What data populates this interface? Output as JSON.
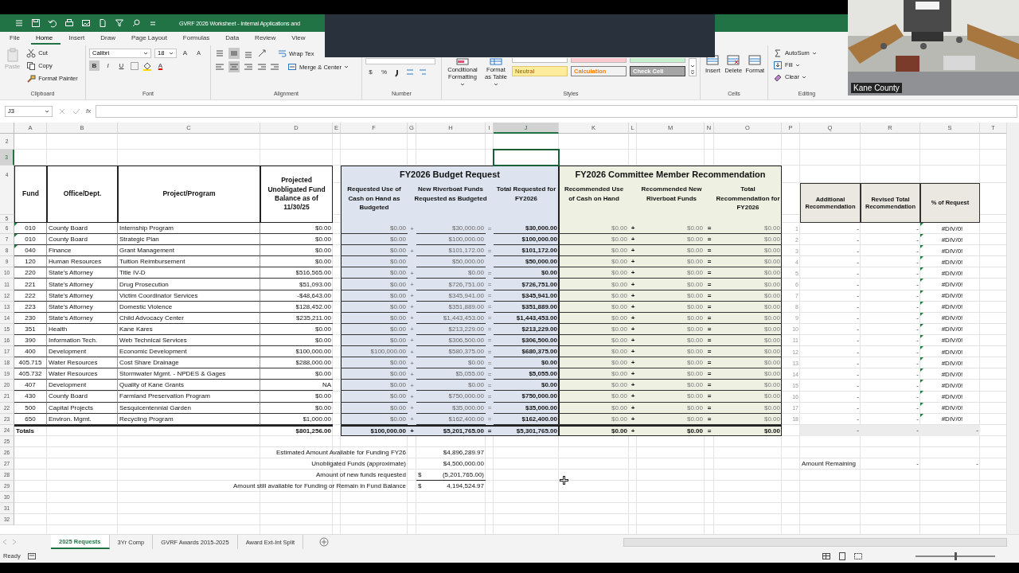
{
  "titlebar": {
    "title": "GVRF 2026 Worksheet - Internal Applications and"
  },
  "menu": [
    {
      "label": "File",
      "selected": false
    },
    {
      "label": "Home",
      "selected": true
    },
    {
      "label": "Insert",
      "selected": false
    },
    {
      "label": "Draw",
      "selected": false
    },
    {
      "label": "Page Layout",
      "selected": false
    },
    {
      "label": "Formulas",
      "selected": false
    },
    {
      "label": "Data",
      "selected": false
    },
    {
      "label": "Review",
      "selected": false
    },
    {
      "label": "View",
      "selected": false
    }
  ],
  "ribbon": {
    "clipboard": {
      "label": "Clipboard",
      "paste": {
        "text": "Paste",
        "disabled": true
      },
      "cut": "Cut",
      "copy": "Copy",
      "format_painter": "Format Painter"
    },
    "font": {
      "label": "Font",
      "family": "Calibri",
      "size": "18",
      "grow": "A",
      "shrink": "A",
      "bold": {
        "text": "B",
        "on": true
      },
      "italic": "I",
      "underline": "U",
      "font_color": "A"
    },
    "alignment": {
      "label": "Alignment",
      "middle_align_on": true,
      "center_align_on": true,
      "wrap_text": "Wrap Tex",
      "merge": "Merge & Center"
    },
    "number": {
      "label": "Number",
      "currency": "$",
      "percent": "%"
    },
    "styles": {
      "label": "Styles",
      "conditional": "Conditional Formatting",
      "format_table": "Format as Table",
      "swatches": [
        {
          "color": "#ffffff"
        },
        {
          "color": "#ffc7ce"
        },
        {
          "color": "#c6efce"
        }
      ],
      "cell_styles": [
        {
          "text": "Neutral",
          "kind": "neutral"
        },
        {
          "text": "Calculation",
          "kind": "calculation"
        },
        {
          "text": "Check Cell",
          "kind": "check"
        }
      ]
    },
    "cells": {
      "label": "Cells",
      "buttons": [
        "Insert",
        "Delete",
        "Format"
      ]
    },
    "editing": {
      "label": "Editing",
      "autosum": "AutoSum",
      "fill": "Fill",
      "clear": "Clear"
    }
  },
  "formula_bar": {
    "name_box": "J3",
    "fx": "fx"
  },
  "video": {
    "kind": "picture",
    "caption": "Kane County"
  },
  "sheet": {
    "columns": [
      {
        "label": "A",
        "selected": false
      },
      {
        "label": "B",
        "selected": false
      },
      {
        "label": "C",
        "selected": false
      },
      {
        "label": "D",
        "selected": false
      },
      {
        "label": "E",
        "selected": false
      },
      {
        "label": "F",
        "selected": false
      },
      {
        "label": "G",
        "selected": false
      },
      {
        "label": "H",
        "selected": false
      },
      {
        "label": "I",
        "selected": false
      },
      {
        "label": "J",
        "selected": true
      },
      {
        "label": "K",
        "selected": false
      },
      {
        "label": "L",
        "selected": false
      },
      {
        "label": "M",
        "selected": false
      },
      {
        "label": "N",
        "selected": false
      },
      {
        "label": "O",
        "selected": false
      },
      {
        "label": "P",
        "selected": false
      },
      {
        "label": "Q",
        "selected": false
      },
      {
        "label": "R",
        "selected": false
      },
      {
        "label": "S",
        "selected": false
      },
      {
        "label": "T",
        "selected": false
      }
    ],
    "top_rows": [
      {
        "row": "2",
        "selected": false
      },
      {
        "row": "3",
        "selected": true
      }
    ],
    "header_rows": [
      "4",
      "5"
    ],
    "headers": {
      "fund": "Fund",
      "office": "Office/Dept.",
      "project": "Project/Program",
      "balance": "Projected Unobligated Fund Balance as of 11/30/25",
      "budget_title": "FY2026 Budget Request",
      "cash": "Requested Use of Cash on Hand as Budgeted",
      "new": "New Riverboat Funds Requested as Budgeted",
      "total": "Total Requested for FY2026",
      "rec_title": "FY2026 Committee Member Recommendation",
      "rec_cash": "Recommended Use of Cash on Hand",
      "rec_new": "Recommended New Riverboat Funds",
      "rec_total": "Total Recommendation for FY2026",
      "additional": "Additional Recommendation",
      "revised": "Revised Total Recommendation",
      "percent": "% of Request"
    },
    "rows": [
      {
        "row": "6",
        "flag": true,
        "fund": "010",
        "office": "County Board",
        "project": "Internship Program",
        "balance": "$0.00",
        "cash": "$0.00",
        "op": "+",
        "new": "$30,000.00",
        "eq": "=",
        "total": "$30,000.00",
        "rec_cash": "$0.00",
        "rec_op": "+",
        "rec_new": "$0.00",
        "rec_eq": "=",
        "rec_total": "$0.00",
        "index": "1",
        "additional": "-",
        "revised": "-",
        "percent": "#DIV/0!"
      },
      {
        "row": "7",
        "flag": true,
        "fund": "010",
        "office": "County Board",
        "project": "Strategic Plan",
        "balance": "$0.00",
        "cash": "$0.00",
        "new": "$100,000.00",
        "total": "$100,000.00",
        "rec_cash": "$0.00",
        "rec_op": "+",
        "rec_new": "$0.00",
        "rec_eq": "=",
        "rec_total": "$0.00",
        "index": "2",
        "additional": "-",
        "revised": "-",
        "percent": "#DIV/0!"
      },
      {
        "row": "8",
        "flag": true,
        "fund": "040",
        "office": "Finance",
        "project": "Grant Management",
        "balance": "$0.00",
        "cash": "$0.00",
        "op": "+",
        "new": "$101,172.00",
        "eq": "=",
        "total": "$101,172.00",
        "rec_cash": "$0.00",
        "rec_op": "+",
        "rec_new": "$0.00",
        "rec_eq": "=",
        "rec_total": "$0.00",
        "index": "3",
        "additional": "-",
        "revised": "-",
        "percent": "#DIV/0!"
      },
      {
        "row": "9",
        "flag": false,
        "fund": "120",
        "office": "Human Resources",
        "project": "Tuition Reimbursement",
        "balance": "$0.00",
        "cash": "$0.00",
        "new": "$50,000.00",
        "total": "$50,000.00",
        "rec_cash": "$0.00",
        "rec_op": "+",
        "rec_new": "$0.00",
        "rec_eq": "=",
        "rec_total": "$0.00",
        "index": "4",
        "additional": "-",
        "revised": "-",
        "percent": "#DIV/0!"
      },
      {
        "row": "10",
        "flag": false,
        "fund": "220",
        "office": "State's Attorney",
        "project": "Title IV-D",
        "balance": "$516,565.00",
        "cash": "$0.00",
        "op": "+",
        "new": "$0.00",
        "eq": "=",
        "total": "$0.00",
        "rec_cash": "$0.00",
        "rec_op": "+",
        "rec_new": "$0.00",
        "rec_eq": "=",
        "rec_total": "$0.00",
        "index": "5",
        "additional": "-",
        "revised": "-",
        "percent": "#DIV/0!"
      },
      {
        "row": "11",
        "flag": false,
        "fund": "221",
        "office": "State's Attorney",
        "project": "Drug Prosecution",
        "balance": "$51,093.00",
        "cash": "$0.00",
        "op": "+",
        "new": "$726,751.00",
        "eq": "=",
        "total": "$726,751.00",
        "rec_cash": "$0.00",
        "rec_op": "+",
        "rec_new": "$0.00",
        "rec_eq": "=",
        "rec_total": "$0.00",
        "index": "6",
        "additional": "-",
        "revised": "-",
        "percent": "#DIV/0!"
      },
      {
        "row": "12",
        "flag": false,
        "fund": "222",
        "office": "State's Attorney",
        "project": "Victim Coordinator Services",
        "balance": "-$48,643.00",
        "cash": "$0.00",
        "op": "+",
        "new": "$345,941.00",
        "eq": "=",
        "total": "$345,941.00",
        "rec_cash": "$0.00",
        "rec_op": "+",
        "rec_new": "$0.00",
        "rec_eq": "=",
        "rec_total": "$0.00",
        "index": "7",
        "additional": "-",
        "revised": "-",
        "percent": "#DIV/0!"
      },
      {
        "row": "13",
        "flag": false,
        "fund": "223",
        "office": "State's Attorney",
        "project": "Domestic Violence",
        "balance": "$128,452.00",
        "cash": "$0.00",
        "op": "+",
        "new": "$351,889.00",
        "eq": "=",
        "total": "$351,889.00",
        "rec_cash": "$0.00",
        "rec_op": "+",
        "rec_new": "$0.00",
        "rec_eq": "=",
        "rec_total": "$0.00",
        "index": "8",
        "additional": "-",
        "revised": "-",
        "percent": "#DIV/0!"
      },
      {
        "row": "14",
        "flag": false,
        "fund": "230",
        "office": "State's Attorney",
        "project": "Child Advocacy Center",
        "balance": "$235,211.00",
        "cash": "$0.00",
        "op": "+",
        "new": "$1,443,453.00",
        "eq": "=",
        "total": "$1,443,453.00",
        "rec_cash": "$0.00",
        "rec_op": "+",
        "rec_new": "$0.00",
        "rec_eq": "=",
        "rec_total": "$0.00",
        "index": "9",
        "additional": "-",
        "revised": "-",
        "percent": "#DIV/0!"
      },
      {
        "row": "15",
        "flag": false,
        "fund": "351",
        "office": "Health",
        "project": "Kane Kares",
        "balance": "$0.00",
        "cash": "$0.00",
        "op": "+",
        "new": "$213,229.00",
        "eq": "=",
        "total": "$213,229.00",
        "rec_cash": "$0.00",
        "rec_op": "+",
        "rec_new": "$0.00",
        "rec_eq": "=",
        "rec_total": "$0.00",
        "index": "10",
        "additional": "-",
        "revised": "-",
        "percent": "#DIV/0!"
      },
      {
        "row": "16",
        "flag": false,
        "fund": "390",
        "office": "Information Tech.",
        "project": "Web Technical Services",
        "balance": "$0.00",
        "cash": "$0.00",
        "op": "+",
        "new": "$306,500.00",
        "eq": "=",
        "total": "$306,500.00",
        "rec_cash": "$0.00",
        "rec_op": "+",
        "rec_new": "$0.00",
        "rec_eq": "=",
        "rec_total": "$0.00",
        "index": "11",
        "additional": "-",
        "revised": "-",
        "percent": "#DIV/0!"
      },
      {
        "row": "17",
        "flag": false,
        "fund": "400",
        "office": "Development",
        "project": "Economic Development",
        "balance": "$100,000.00",
        "cash": "$100,000.00",
        "op": "+",
        "new": "$580,375.00",
        "eq": "=",
        "total": "$680,375.00",
        "rec_cash": "$0.00",
        "rec_op": "+",
        "rec_new": "$0.00",
        "rec_eq": "=",
        "rec_total": "$0.00",
        "index": "12",
        "additional": "-",
        "revised": "-",
        "percent": "#DIV/0!"
      },
      {
        "row": "18",
        "flag": false,
        "fund": "405.715",
        "office": "Water Resources",
        "project": "Cost Share Drainage",
        "balance": "$288,000.00",
        "cash": "$0.00",
        "op": "+",
        "new": "$0.00",
        "eq": "=",
        "total": "$0.00",
        "rec_cash": "$0.00",
        "rec_op": "+",
        "rec_new": "$0.00",
        "rec_eq": "=",
        "rec_total": "$0.00",
        "index": "13",
        "additional": "-",
        "revised": "-",
        "percent": "#DIV/0!"
      },
      {
        "row": "19",
        "flag": false,
        "fund": "405.732",
        "office": "Water Resources",
        "project": "Stormwater Mgmt. - NPDES & Gages",
        "balance": "$0.00",
        "cash": "$0.00",
        "op": "+",
        "new": "$5,055.00",
        "eq": "=",
        "total": "$5,055.00",
        "rec_cash": "$0.00",
        "rec_op": "+",
        "rec_new": "$0.00",
        "rec_eq": "=",
        "rec_total": "$0.00",
        "index": "14",
        "additional": "-",
        "revised": "-",
        "percent": "#DIV/0!"
      },
      {
        "row": "20",
        "flag": false,
        "fund": "407",
        "office": "Development",
        "project": "Quality of Kane Grants",
        "balance": "NA",
        "cash": "$0.00",
        "op": "+",
        "new": "$0.00",
        "eq": "=",
        "total": "$0.00",
        "rec_cash": "$0.00",
        "rec_op": "+",
        "rec_new": "$0.00",
        "rec_eq": "=",
        "rec_total": "$0.00",
        "index": "15",
        "additional": "-",
        "revised": "-",
        "percent": "#DIV/0!"
      },
      {
        "row": "21",
        "flag": false,
        "fund": "430",
        "office": "County Board",
        "project": "Farmland Preservation Program",
        "balance": "$0.00",
        "cash": "$0.00",
        "op": "+",
        "new": "$750,000.00",
        "eq": "=",
        "total": "$750,000.00",
        "rec_cash": "$0.00",
        "rec_op": "+",
        "rec_new": "$0.00",
        "rec_eq": "=",
        "rec_total": "$0.00",
        "index": "16",
        "additional": "-",
        "revised": "-",
        "percent": "#DIV/0!"
      },
      {
        "row": "22",
        "flag": false,
        "fund": "500",
        "office": "Capital Projects",
        "project": "Sesquicentennial Garden",
        "balance": "$0.00",
        "cash": "$0.00",
        "op": "+",
        "new": "$35,000.00",
        "eq": "=",
        "total": "$35,000.00",
        "rec_cash": "$0.00",
        "rec_op": "+",
        "rec_new": "$0.00",
        "rec_eq": "=",
        "rec_total": "$0.00",
        "index": "17",
        "additional": "-",
        "revised": "-",
        "percent": "#DIV/0!"
      },
      {
        "row": "23",
        "flag": false,
        "fund": "650",
        "office": "Environ. Mgmt.",
        "project": "Recycling Program",
        "balance": "$1,000.00",
        "cash": "$0.00",
        "op": "+",
        "new": "$162,400.00",
        "eq": "=",
        "total": "$162,400.00",
        "rec_cash": "$0.00",
        "rec_op": "+",
        "rec_new": "$0.00",
        "rec_eq": "=",
        "rec_total": "$0.00",
        "index": "18",
        "additional": "-",
        "revised": "-",
        "percent": "#DIV/0!"
      }
    ],
    "totals": {
      "row": "24",
      "fund": "Totals",
      "balance": "$801,256.00",
      "cash": "$100,000.00",
      "op": "+",
      "new": "$5,201,765.00",
      "eq": "=",
      "total": "$5,301,765.00",
      "rec_cash": "$0.00",
      "rec_op": "+",
      "rec_new": "$0.00",
      "rec_eq": "=",
      "rec_total": "$0.00",
      "additional": "-",
      "revised": "-",
      "percent": "-"
    },
    "lower_rows": [
      {
        "row": "25"
      },
      {
        "row": "26",
        "label": "Estimated Amount Available for Funding FY26",
        "value": "$4,896,289.97"
      },
      {
        "row": "27",
        "label": "Unobligated Funds (approximate)",
        "value": "$4,500,000.00",
        "additional": "Amount Remaining",
        "revised": "-",
        "percent": "-"
      },
      {
        "row": "28",
        "label": "Amount of new funds requested",
        "symbol": "$",
        "value": "(5,201,765.00)",
        "underline": true
      },
      {
        "row": "29",
        "label": "Amount still available for Funding or Remain in Fund Balance",
        "symbol": "$",
        "value": "4,194,524.97"
      },
      {
        "row": "30"
      },
      {
        "row": "31"
      },
      {
        "row": "32"
      }
    ]
  },
  "sheet_tabs": [
    {
      "label": "2025 Requests",
      "selected": true
    },
    {
      "label": "3Yr Comp",
      "selected": false
    },
    {
      "label": "GVRF Awards 2015-2025",
      "selected": false
    },
    {
      "label": "Award Ext-Int Split",
      "selected": false
    }
  ],
  "status_bar": {
    "text": "Ready",
    "zoom": {
      "level": 0.5
    }
  }
}
